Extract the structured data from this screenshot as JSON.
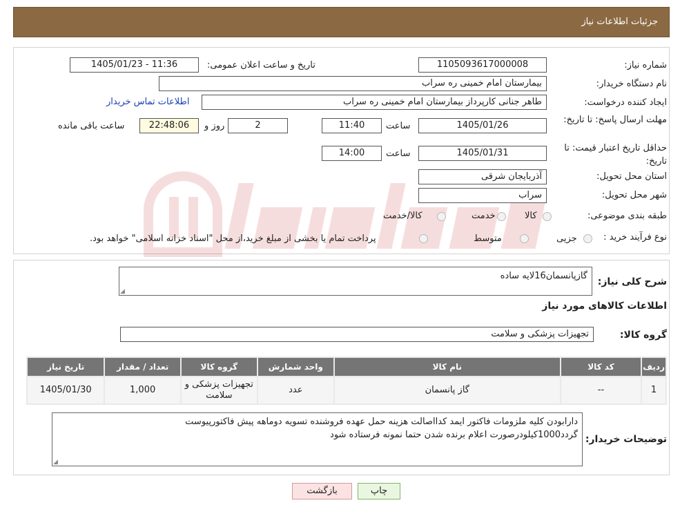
{
  "header": {
    "title": "جزئیات اطلاعات نیاز"
  },
  "info": {
    "need_number_label": "شماره نیاز:",
    "need_number": "1105093617000008",
    "announce_label": "تاریخ و ساعت اعلان عمومی:",
    "announce_value": "1405/01/23 - 11:36",
    "buyer_label": "نام دستگاه خریدار:",
    "buyer_value": "بیمارستان امام خمینی ره  سراب",
    "creator_label": "ایجاد کننده درخواست:",
    "creator_value": "طاهر جنانی کارپرداز بیمارستان امام خمینی ره  سراب",
    "contact_link": "اطلاعات تماس خریدار",
    "deadline_label": "مهلت ارسال پاسخ: تا تاریخ:",
    "deadline_date": "1405/01/26",
    "time_label": "ساعت",
    "deadline_time": "11:40",
    "days_value": "2",
    "days_label": "روز و",
    "remaining_value": "22:48:06",
    "remaining_label": "ساعت باقی مانده",
    "validity_label": "حداقل تاریخ اعتبار قیمت: تا تاریخ:",
    "validity_date": "1405/01/31",
    "validity_time": "14:00",
    "province_label": "استان محل تحویل:",
    "province_value": "آذربایجان شرقی",
    "city_label": "شهر محل تحویل:",
    "city_value": "سراب",
    "category_label": "طبقه بندی موضوعی:",
    "category_options": [
      "کالا",
      "خدمت",
      "کالا/خدمت"
    ],
    "process_label": "نوع فرآیند خرید :",
    "process_options": [
      "جزیی",
      "متوسط"
    ],
    "process_note": "پرداخت تمام یا بخشی از مبلغ خرید،از محل \"اسناد خزانه اسلامی\" خواهد بود."
  },
  "details": {
    "summary_label": "شرح کلی نیاز:",
    "summary_value": "گازپانسمان16لایه ساده",
    "goods_info_title": "اطلاعات کالاهای مورد نیاز",
    "group_label": "گروه کالا:",
    "group_value": "تجهیزات پزشکی و سلامت",
    "table": {
      "headers": [
        "ردیف",
        "کد کالا",
        "نام کالا",
        "واحد شمارش",
        "گروه کالا",
        "تعداد / مقدار",
        "تاریخ نیاز"
      ],
      "rows": [
        [
          "1",
          "--",
          "گاز پانسمان",
          "عدد",
          "تجهیزات پزشکی و سلامت",
          "1,000",
          "1405/01/30"
        ]
      ]
    },
    "buyer_notes_label": "توضیحات خریدار:",
    "buyer_notes_line1": "دارابودن کلیه ملزومات فاکتور ایمد کدااصالت هزینه حمل عهده فروشنده تسویه دوماهه پیش فاکتورپیوست",
    "buyer_notes_line2": "گردد1000کیلودرصورت اعلام برنده شدن حتما نمونه فرستاده شود"
  },
  "buttons": {
    "print": "چاپ",
    "back": "بازگشت"
  },
  "colors": {
    "header_bg": "#8b6a43",
    "table_header_bg": "#757575",
    "link": "#1a3fb5"
  }
}
